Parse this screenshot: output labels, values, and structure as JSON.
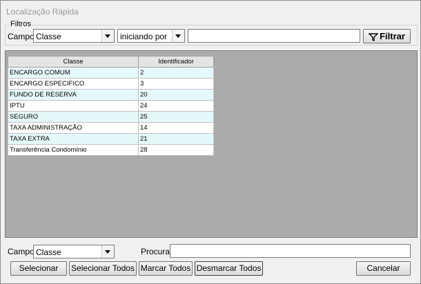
{
  "window": {
    "title": "Localização Rápida"
  },
  "filters": {
    "legend": "Filtros",
    "campo_label": "Campo:",
    "campo_value": "Classe",
    "mode_value": "iniciando por",
    "search_value": "",
    "filter_button": "Filtrar"
  },
  "grid": {
    "columns": [
      "Classe",
      "Identificador"
    ],
    "rows": [
      [
        "ENCARGO COMUM",
        "2"
      ],
      [
        "ENCARGO ESPECIFICO",
        "3"
      ],
      [
        "FUNDO DE RESERVA",
        "20"
      ],
      [
        "IPTU",
        "24"
      ],
      [
        "SEGURO",
        "25"
      ],
      [
        "TAXA ADMINISTRAÇÃO",
        "14"
      ],
      [
        "TAXA EXTRA",
        "21"
      ],
      [
        "Transferência Condomínio",
        "28"
      ]
    ]
  },
  "bottom": {
    "campo_label": "Campo:",
    "campo_value": "Classe",
    "procura_label": "Procura:",
    "procura_value": ""
  },
  "buttons": {
    "selecionar": "Selecionar",
    "selecionar_todos": "Selecionar Todos",
    "marcar_todos": "Marcar Todos",
    "desmarcar_todos": "Desmarcar Todos",
    "cancelar": "Cancelar"
  }
}
